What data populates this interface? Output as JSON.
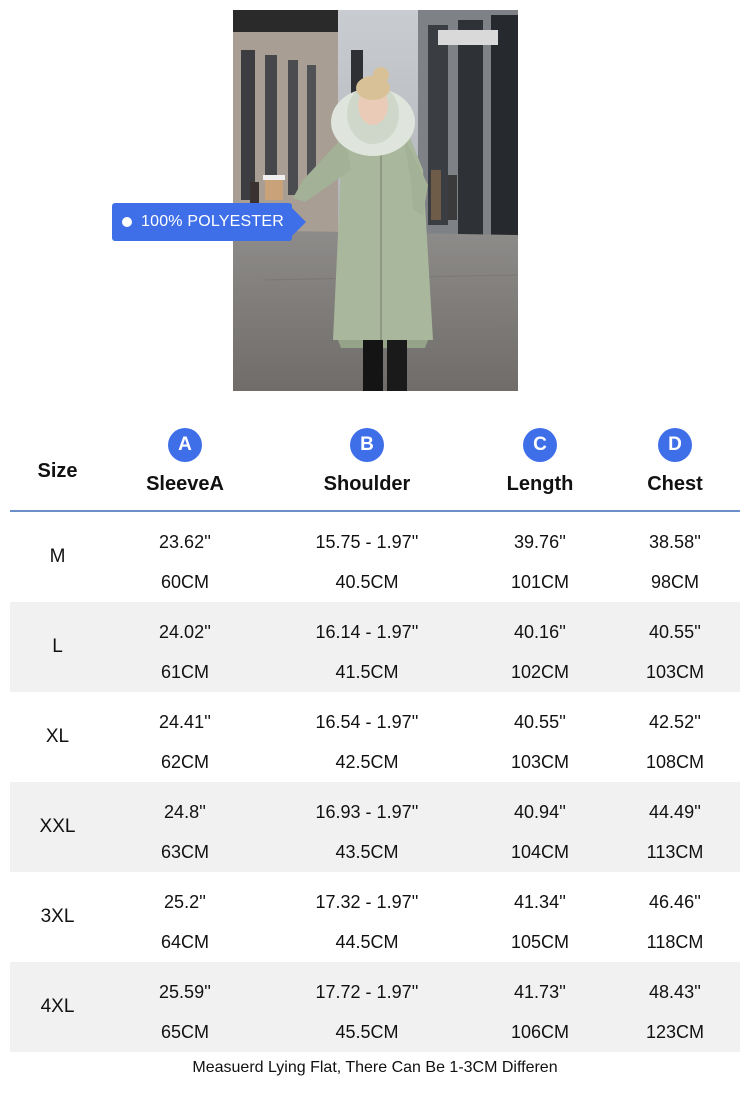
{
  "product": {
    "image_alt_icon": "coat-photo",
    "material_tag": "100% POLYESTER"
  },
  "size_chart": {
    "size_header": "Size",
    "columns": [
      {
        "badge": "A",
        "label": "SleeveA"
      },
      {
        "badge": "B",
        "label": "Shoulder"
      },
      {
        "badge": "C",
        "label": "Length"
      },
      {
        "badge": "D",
        "label": "Chest"
      }
    ],
    "rows": [
      {
        "size": "M",
        "values": [
          {
            "in": "23.62''",
            "cm": "60CM"
          },
          {
            "in": "15.75 - 1.97''",
            "cm": "40.5CM"
          },
          {
            "in": "39.76''",
            "cm": "101CM"
          },
          {
            "in": "38.58''",
            "cm": "98CM"
          }
        ]
      },
      {
        "size": "L",
        "values": [
          {
            "in": "24.02''",
            "cm": "61CM"
          },
          {
            "in": "16.14 - 1.97''",
            "cm": "41.5CM"
          },
          {
            "in": "40.16''",
            "cm": "102CM"
          },
          {
            "in": "40.55''",
            "cm": "103CM"
          }
        ]
      },
      {
        "size": "XL",
        "values": [
          {
            "in": "24.41''",
            "cm": "62CM"
          },
          {
            "in": "16.54 - 1.97''",
            "cm": "42.5CM"
          },
          {
            "in": "40.55''",
            "cm": "103CM"
          },
          {
            "in": "42.52''",
            "cm": "108CM"
          }
        ]
      },
      {
        "size": "XXL",
        "values": [
          {
            "in": "24.8''",
            "cm": "63CM"
          },
          {
            "in": "16.93 - 1.97''",
            "cm": "43.5CM"
          },
          {
            "in": "40.94''",
            "cm": "104CM"
          },
          {
            "in": "44.49''",
            "cm": "113CM"
          }
        ]
      },
      {
        "size": "3XL",
        "values": [
          {
            "in": "25.2''",
            "cm": "64CM"
          },
          {
            "in": "17.32 - 1.97''",
            "cm": "44.5CM"
          },
          {
            "in": "41.34''",
            "cm": "105CM"
          },
          {
            "in": "46.46''",
            "cm": "118CM"
          }
        ]
      },
      {
        "size": "4XL",
        "values": [
          {
            "in": "25.59''",
            "cm": "65CM"
          },
          {
            "in": "17.72 - 1.97''",
            "cm": "45.5CM"
          },
          {
            "in": "41.73''",
            "cm": "106CM"
          },
          {
            "in": "48.43''",
            "cm": "123CM"
          }
        ]
      }
    ],
    "footnote": "Measuerd Lying Flat, There Can Be 1-3CM Differen"
  },
  "colors": {
    "accent": "#3f6fe8",
    "divider": "#6b8fc9",
    "stripe": "#f1f1f1",
    "coat": "#a9b79c"
  }
}
